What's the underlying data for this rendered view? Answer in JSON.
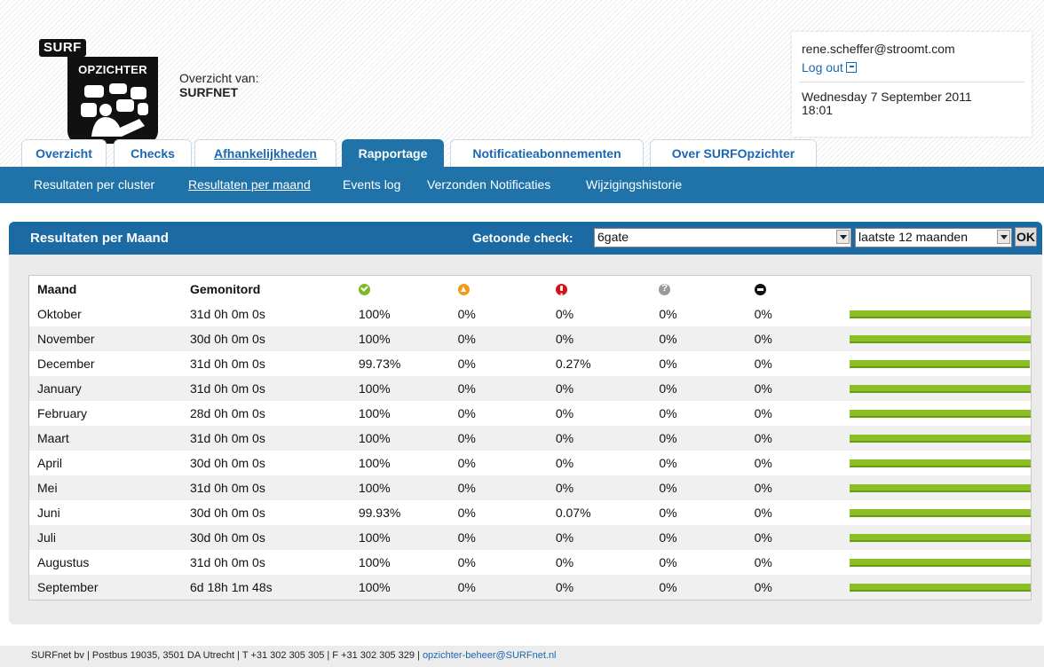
{
  "branding": {
    "tag": "SURF",
    "name": "OPZICHTER"
  },
  "overview": {
    "label": "Overzicht van:",
    "org": "SURFNET"
  },
  "user": {
    "email": "rene.scheffer@stroomt.com",
    "logout": "Log out",
    "date": "Wednesday 7 September 2011",
    "time": "18:01"
  },
  "tabs": [
    {
      "label": "Overzicht"
    },
    {
      "label": "Checks"
    },
    {
      "label": "Afhankelijkheden"
    },
    {
      "label": "Rapportage",
      "active": true
    },
    {
      "label": "Notificatieabonnementen"
    },
    {
      "label": "Over SURFOpzichter"
    }
  ],
  "subnav": [
    {
      "label": "Resultaten per cluster"
    },
    {
      "label": "Resultaten per maand",
      "selected": true
    },
    {
      "label": "Events log"
    },
    {
      "label": "Verzonden Notificaties"
    },
    {
      "label": "Wijzigingshistorie"
    }
  ],
  "panel": {
    "title": "Resultaten per Maand",
    "check_label": "Getoonde check:",
    "check_value": "6gate",
    "period_value": "laatste 12 maanden",
    "ok_label": "OK"
  },
  "table": {
    "headers": [
      "Maand",
      "Gemonitord"
    ],
    "status_icons": [
      "ok-icon",
      "warning-icon",
      "critical-icon",
      "unknown-icon",
      "down-icon"
    ],
    "colors": {
      "bar": "#8cbf26",
      "header": "#1f73a9"
    },
    "rows": [
      {
        "month": "Oktober",
        "monitored": "31d 0h 0m 0s",
        "ok": "100%",
        "warn": "0%",
        "crit": "0%",
        "unknown": "0%",
        "down": "0%",
        "uptime": 1.0
      },
      {
        "month": "November",
        "monitored": "30d 0h 0m 0s",
        "ok": "100%",
        "warn": "0%",
        "crit": "0%",
        "unknown": "0%",
        "down": "0%",
        "uptime": 1.0
      },
      {
        "month": "December",
        "monitored": "31d 0h 0m 0s",
        "ok": "99.73%",
        "warn": "0%",
        "crit": "0.27%",
        "unknown": "0%",
        "down": "0%",
        "uptime": 0.9973
      },
      {
        "month": "January",
        "monitored": "31d 0h 0m 0s",
        "ok": "100%",
        "warn": "0%",
        "crit": "0%",
        "unknown": "0%",
        "down": "0%",
        "uptime": 1.0
      },
      {
        "month": "February",
        "monitored": "28d 0h 0m 0s",
        "ok": "100%",
        "warn": "0%",
        "crit": "0%",
        "unknown": "0%",
        "down": "0%",
        "uptime": 1.0
      },
      {
        "month": "Maart",
        "monitored": "31d 0h 0m 0s",
        "ok": "100%",
        "warn": "0%",
        "crit": "0%",
        "unknown": "0%",
        "down": "0%",
        "uptime": 1.0
      },
      {
        "month": "April",
        "monitored": "30d 0h 0m 0s",
        "ok": "100%",
        "warn": "0%",
        "crit": "0%",
        "unknown": "0%",
        "down": "0%",
        "uptime": 1.0
      },
      {
        "month": "Mei",
        "monitored": "31d 0h 0m 0s",
        "ok": "100%",
        "warn": "0%",
        "crit": "0%",
        "unknown": "0%",
        "down": "0%",
        "uptime": 1.0
      },
      {
        "month": "Juni",
        "monitored": "30d 0h 0m 0s",
        "ok": "99.93%",
        "warn": "0%",
        "crit": "0.07%",
        "unknown": "0%",
        "down": "0%",
        "uptime": 0.9993
      },
      {
        "month": "Juli",
        "monitored": "30d 0h 0m 0s",
        "ok": "100%",
        "warn": "0%",
        "crit": "0%",
        "unknown": "0%",
        "down": "0%",
        "uptime": 1.0
      },
      {
        "month": "Augustus",
        "monitored": "31d 0h 0m 0s",
        "ok": "100%",
        "warn": "0%",
        "crit": "0%",
        "unknown": "0%",
        "down": "0%",
        "uptime": 1.0
      },
      {
        "month": "September",
        "monitored": "6d 18h 1m 48s",
        "ok": "100%",
        "warn": "0%",
        "crit": "0%",
        "unknown": "0%",
        "down": "0%",
        "uptime": 1.0
      }
    ]
  },
  "footer": {
    "text": "SURFnet bv | Postbus 19035, 3501 DA Utrecht | T +31 302 305 305 | F +31 302 305 329 | ",
    "email": "opzichter-beheer@SURFnet.nl"
  }
}
